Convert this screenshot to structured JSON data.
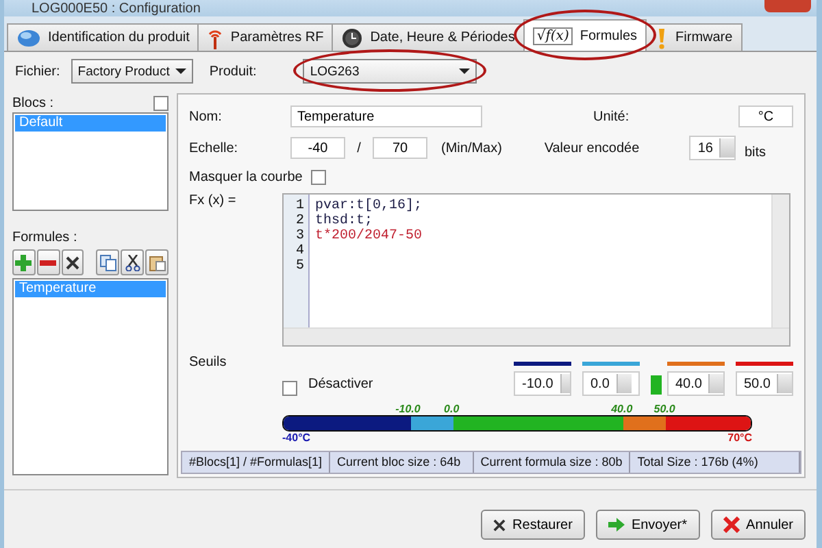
{
  "window": {
    "title": "LOG000E50 : Configuration"
  },
  "tabs": [
    {
      "label": "Identification du produit",
      "kind": "globe",
      "selected": false,
      "circled": false
    },
    {
      "label": "Paramètres RF",
      "kind": "antenna",
      "selected": false,
      "circled": false
    },
    {
      "label": "Date, Heure & Périodes",
      "kind": "clock",
      "selected": false,
      "circled": false
    },
    {
      "label": "Formules",
      "kind": "formula",
      "symbol": "√f(x)",
      "selected": true,
      "circled": true
    },
    {
      "label": "Firmware",
      "kind": "warning",
      "selected": false,
      "circled": false
    }
  ],
  "file": {
    "label": "Fichier:",
    "value": "Factory Product"
  },
  "product": {
    "label": "Produit:",
    "value": "LOG263",
    "circled": true
  },
  "blocks": {
    "label": "Blocs :",
    "checked": false,
    "items": [
      {
        "label": "Default",
        "selected": true
      }
    ]
  },
  "formulas": {
    "label": "Formules :",
    "items": [
      {
        "label": "Temperature",
        "selected": true
      }
    ]
  },
  "form": {
    "name_label": "Nom:",
    "name": "Temperature",
    "unit_label": "Unité:",
    "unit": "°C",
    "scale_label": "Echelle:",
    "min": "-40",
    "sep": "/",
    "max": "70",
    "minmax_hint": "(Min/Max)",
    "encoded_label": "Valeur encodée",
    "encoded": "16",
    "bits": "bits",
    "hide_label": "Masquer la courbe",
    "hide_checked": false,
    "fx_label": "Fx (x) =",
    "code_lines": [
      {
        "num": "1",
        "text": "pvar:t[0,16];"
      },
      {
        "num": "2",
        "text": "thsd:t;"
      },
      {
        "num": "3",
        "text": "t*200/2047-50"
      },
      {
        "num": "4"
      },
      {
        "num": "5"
      }
    ]
  },
  "thresholds": {
    "label": "Seuils",
    "disable_label": "Désactiver",
    "disabled": false,
    "middle": {
      "color": "#22b422"
    },
    "items": [
      {
        "value": "-10.0",
        "color": "#0c1a80"
      },
      {
        "value": "0.0",
        "color": "#3aa6d8"
      },
      {
        "value": "40.0",
        "color": "#e0701c"
      },
      {
        "value": "50.0",
        "color": "#dd1414"
      }
    ],
    "markers": [
      "-10.0",
      "0.0",
      "40.0",
      "50.0"
    ],
    "min_label": "-40°C",
    "max_label": "70°C"
  },
  "status_bar": [
    "#Blocs[1] / #Formulas[1]",
    "Current bloc size : 64b",
    "Current formula size : 80b",
    "Total Size : 176b (4%)"
  ],
  "buttons": [
    {
      "label": "Restaurer",
      "kind": "restore"
    },
    {
      "label": "Envoyer*",
      "kind": "send"
    },
    {
      "label": "Annuler",
      "kind": "cancel"
    }
  ]
}
